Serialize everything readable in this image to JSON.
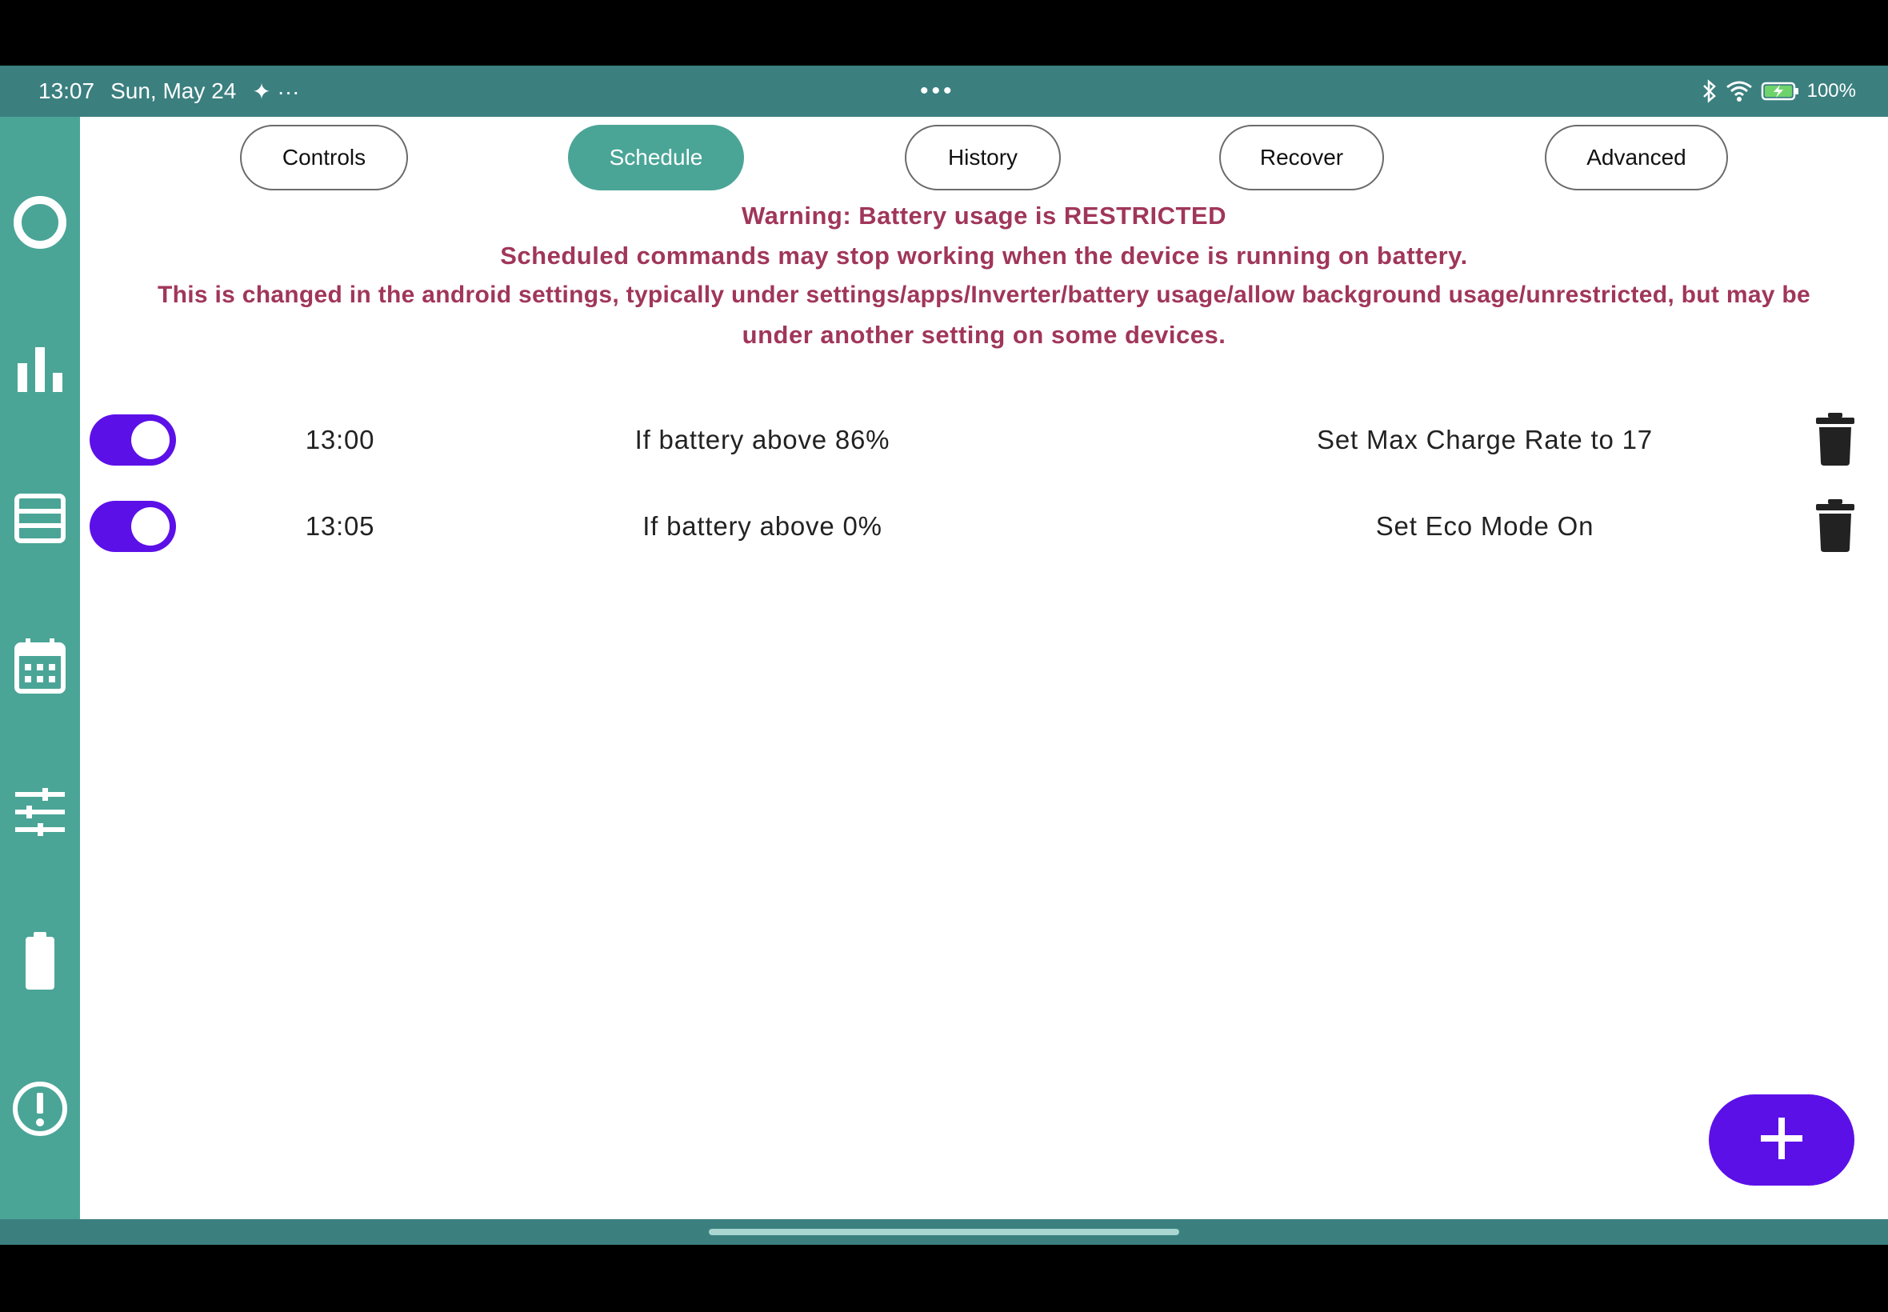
{
  "status_bar": {
    "time": "13:07",
    "date": "Sun, May 24",
    "extra_icons": "✦ ···",
    "center_dots": "•••",
    "battery_percent": "100%"
  },
  "nav_rail": {
    "items": [
      {
        "icon": "circle-icon"
      },
      {
        "icon": "bar-chart-icon"
      },
      {
        "icon": "list-icon"
      },
      {
        "icon": "calendar-icon"
      },
      {
        "icon": "sliders-icon"
      },
      {
        "icon": "battery-icon"
      },
      {
        "icon": "alert-circle-icon"
      }
    ]
  },
  "tabs": {
    "controls": "Controls",
    "schedule": "Schedule",
    "history": "History",
    "recover": "Recover",
    "advanced": "Advanced",
    "active": "schedule"
  },
  "warning": {
    "line1": "Warning: Battery usage is RESTRICTED",
    "line2": "Scheduled commands may stop working when the device is running on battery.",
    "line3": "This is changed in the android settings, typically under settings/apps/Inverter/battery usage/allow background usage/unrestricted, but may be",
    "line4": "under another setting on some devices."
  },
  "schedule": [
    {
      "enabled": true,
      "time": "13:00",
      "condition": "If battery above 86%",
      "action": "Set Max Charge Rate to 17"
    },
    {
      "enabled": true,
      "time": "13:05",
      "condition": "If battery above 0%",
      "action": "Set Eco Mode On"
    }
  ],
  "fab": {
    "icon": "plus-icon"
  },
  "colors": {
    "status_bar": "#3b7f7f",
    "nav_rail": "#4aa597",
    "accent": "#5c10e8",
    "warning_text": "#a0365a"
  }
}
